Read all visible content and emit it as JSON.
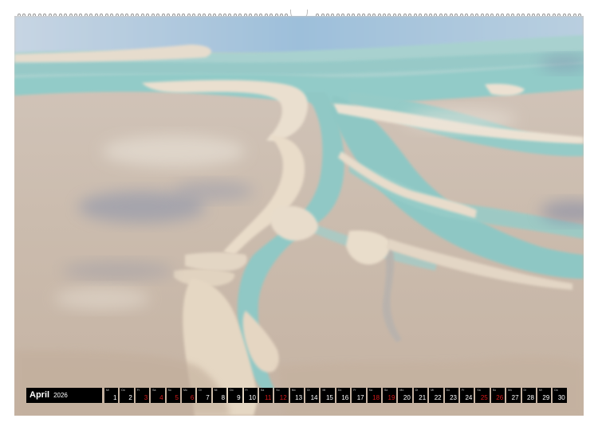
{
  "calendar": {
    "month": "April",
    "year": "2026",
    "accent_color": "#d61a1a",
    "days": [
      {
        "weekday": "Mi",
        "day": "1",
        "red": false
      },
      {
        "weekday": "Do",
        "day": "2",
        "red": false
      },
      {
        "weekday": "Fr",
        "day": "3",
        "red": true
      },
      {
        "weekday": "Sa",
        "day": "4",
        "red": true
      },
      {
        "weekday": "So",
        "day": "5",
        "red": true
      },
      {
        "weekday": "Mo",
        "day": "6",
        "red": true
      },
      {
        "weekday": "Di",
        "day": "7",
        "red": false
      },
      {
        "weekday": "Mi",
        "day": "8",
        "red": false
      },
      {
        "weekday": "Do",
        "day": "9",
        "red": false
      },
      {
        "weekday": "Fr",
        "day": "10",
        "red": false
      },
      {
        "weekday": "Sa",
        "day": "11",
        "red": true
      },
      {
        "weekday": "So",
        "day": "12",
        "red": true
      },
      {
        "weekday": "Mo",
        "day": "13",
        "red": false
      },
      {
        "weekday": "Di",
        "day": "14",
        "red": false
      },
      {
        "weekday": "Mi",
        "day": "15",
        "red": false
      },
      {
        "weekday": "Do",
        "day": "16",
        "red": false
      },
      {
        "weekday": "Fr",
        "day": "17",
        "red": false
      },
      {
        "weekday": "Sa",
        "day": "18",
        "red": true
      },
      {
        "weekday": "So",
        "day": "19",
        "red": true
      },
      {
        "weekday": "Mo",
        "day": "20",
        "red": false
      },
      {
        "weekday": "Di",
        "day": "21",
        "red": false
      },
      {
        "weekday": "Mi",
        "day": "22",
        "red": false
      },
      {
        "weekday": "Do",
        "day": "23",
        "red": false
      },
      {
        "weekday": "Fr",
        "day": "24",
        "red": false
      },
      {
        "weekday": "Sa",
        "day": "25",
        "red": true
      },
      {
        "weekday": "So",
        "day": "26",
        "red": true
      },
      {
        "weekday": "Mo",
        "day": "27",
        "red": false
      },
      {
        "weekday": "Di",
        "day": "28",
        "red": false
      },
      {
        "weekday": "Mi",
        "day": "29",
        "red": false
      },
      {
        "weekday": "Do",
        "day": "30",
        "red": false
      }
    ]
  },
  "photo": {
    "subject": "aerial view of tidal flats with turquoise channels",
    "colors": {
      "sand": "#c9b9aa",
      "sand_light": "#e4d7c6",
      "water": "#8fc9c6",
      "water_deep": "#78b9b6",
      "shadow": "#8d8f9e",
      "sky_blue": "#a9c7dd"
    }
  }
}
